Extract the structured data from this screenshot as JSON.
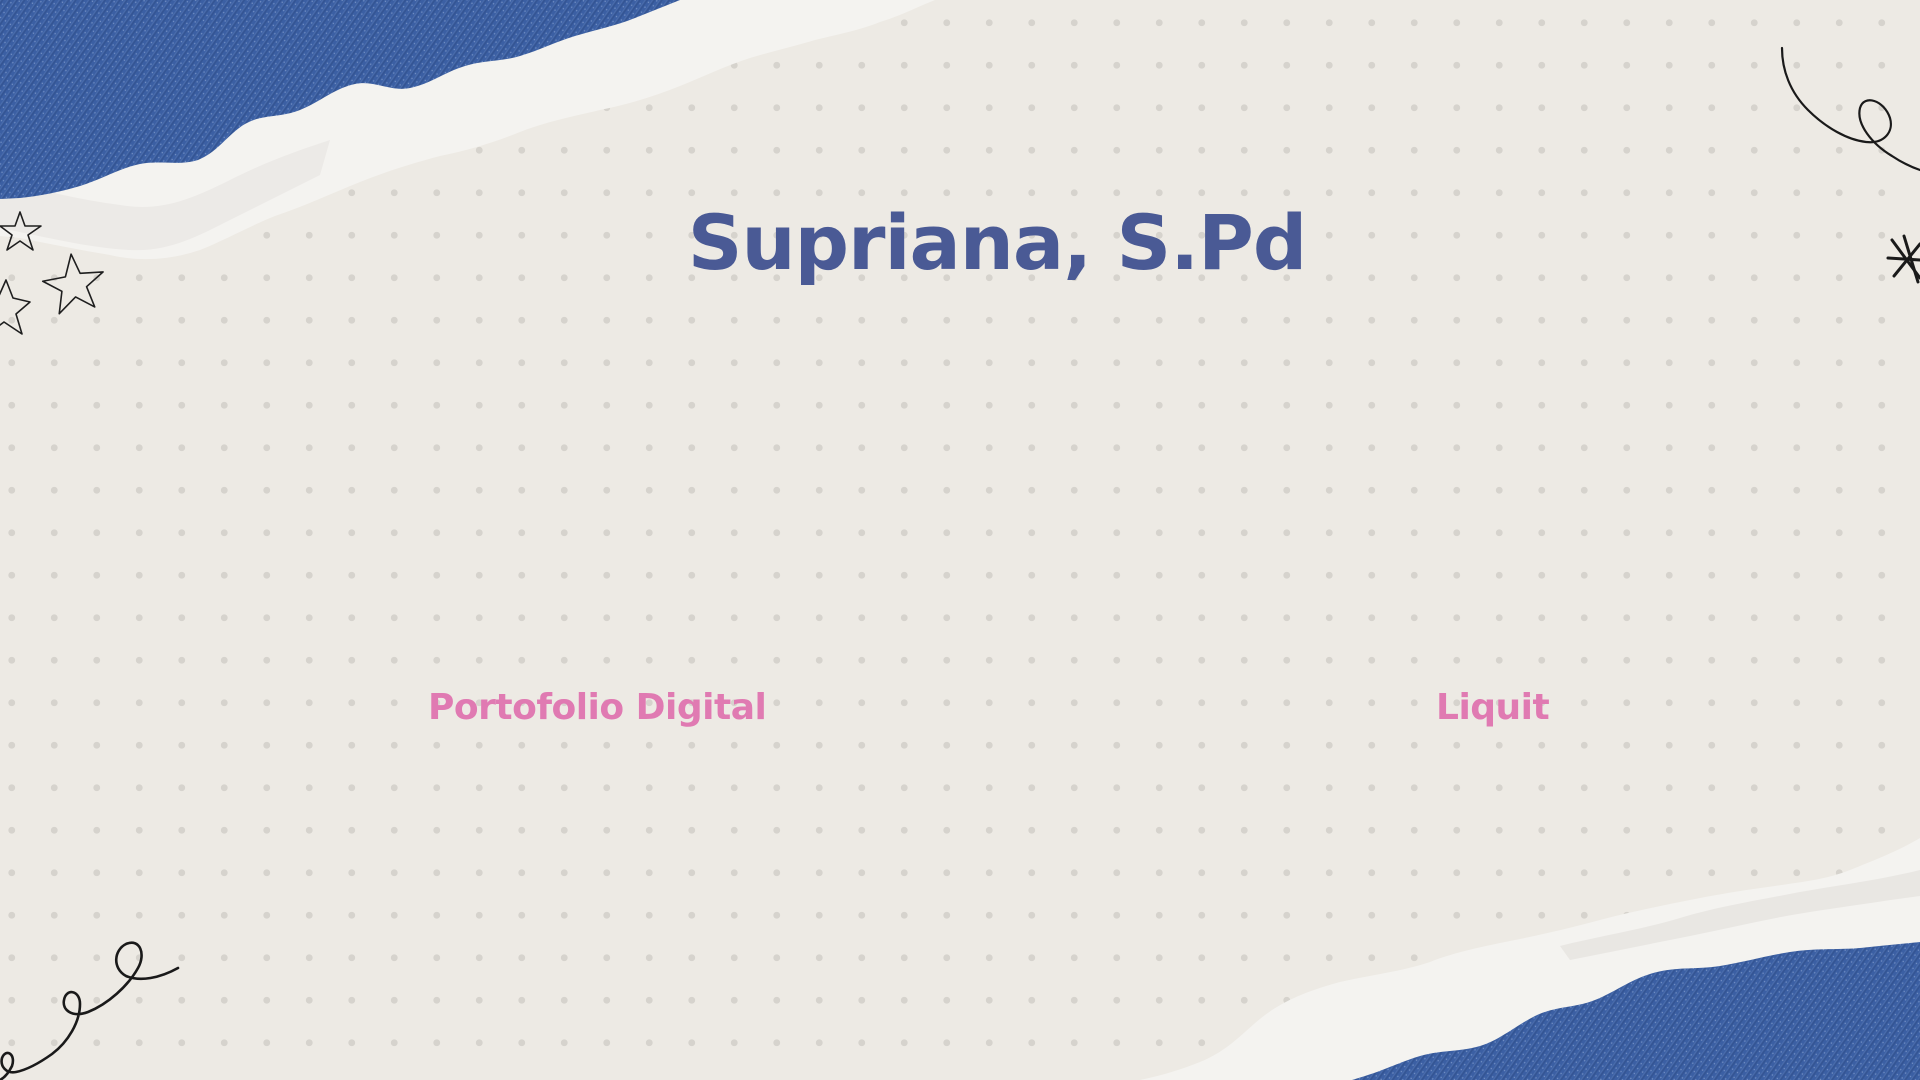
{
  "slide": {
    "title": "Supriana, S.Pd",
    "subtitle_left": "Portofolio Digital",
    "subtitle_right": "Liquit"
  },
  "colors": {
    "background": "#edeae4",
    "dots": "#d6d3cd",
    "title": "#4a5a95",
    "subtitle": "#e07ab2",
    "denim": "#3b5fa3",
    "torn_paper": "#f4f3f0"
  },
  "decorations": [
    "denim-torn-paper-top-left",
    "denim-torn-paper-bottom-right",
    "stars-doodle-left",
    "spiral-doodle-bottom-left",
    "spiral-doodle-top-right",
    "asterisk-doodle-right"
  ]
}
